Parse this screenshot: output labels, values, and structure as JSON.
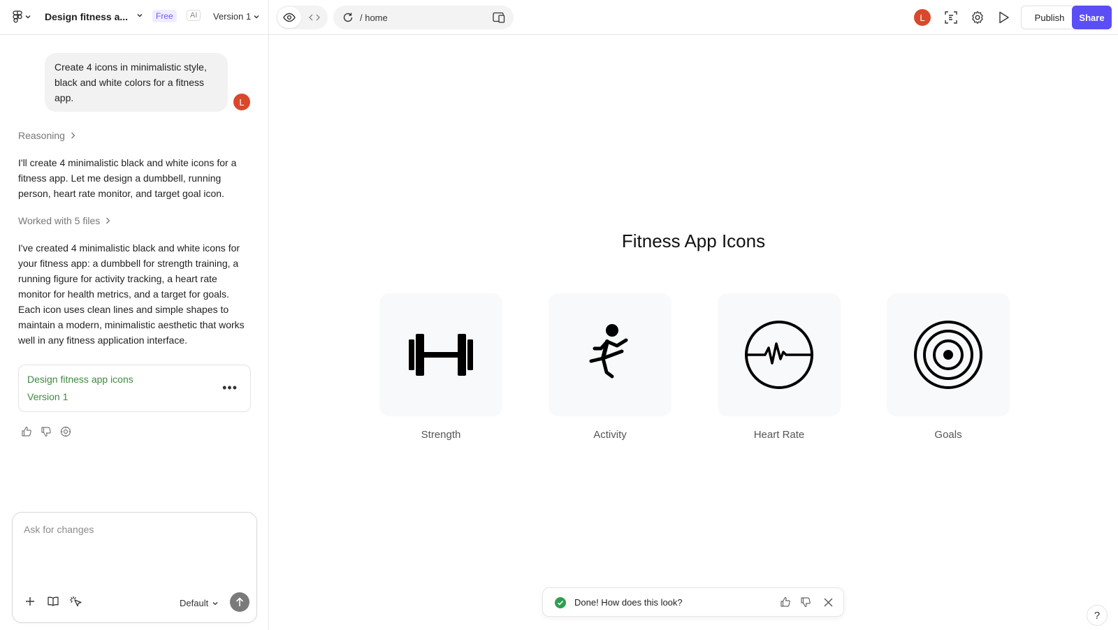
{
  "header": {
    "project_title": "Design fitness a...",
    "plan_badge": "Free",
    "ai_badge": "AI",
    "version_label": "Version 1",
    "url_path": "/  home",
    "user_initial": "L",
    "publish_label": "Publish",
    "share_label": "Share",
    "accent_color": "#5b4ef5"
  },
  "chat": {
    "user_message": "Create 4 icons in minimalistic style, black and white colors for a fitness app.",
    "user_initial": "L",
    "reasoning_label": "Reasoning",
    "assistant_intro": "I'll create 4 minimalistic black and white icons for a fitness app. Let me design a dumbbell, running person, heart rate monitor, and target goal icon.",
    "worked_label": "Worked with 5 files",
    "assistant_summary": "I've created 4 minimalistic black and white icons for your fitness app: a dumbbell for strength training, a running figure for activity tracking, a heart rate monitor for health metrics, and a target for goals. Each icon uses clean lines and simple shapes to maintain a modern, minimalistic aesthetic that works well in any fitness application interface.",
    "version_card": {
      "title": "Design fitness app icons",
      "subtitle": "Version 1",
      "more": "•••"
    }
  },
  "composer": {
    "placeholder": "Ask for changes",
    "model_label": "Default"
  },
  "preview": {
    "title": "Fitness App Icons",
    "icons": [
      {
        "label": "Strength",
        "icon": "dumbbell-icon"
      },
      {
        "label": "Activity",
        "icon": "running-figure-icon"
      },
      {
        "label": "Heart Rate",
        "icon": "heart-rate-icon"
      },
      {
        "label": "Goals",
        "icon": "target-icon"
      }
    ]
  },
  "toast": {
    "message": "Done! How does this look?",
    "success_color": "#2e9e4f"
  },
  "help": {
    "label": "?"
  }
}
